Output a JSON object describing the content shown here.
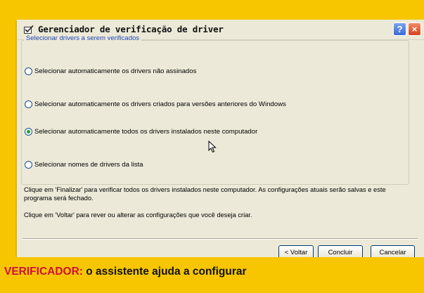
{
  "window": {
    "title": "Gerenciador de verificação de driver",
    "help_label": "?",
    "close_label": "×"
  },
  "group": {
    "legend": "Selecionar drivers a serem verificados",
    "options": [
      {
        "label": "Selecionar automaticamente os drivers não assinados",
        "selected": false
      },
      {
        "label": "Selecionar automaticamente os drivers criados para versões anteriores do Windows",
        "selected": false
      },
      {
        "label": "Selecionar automaticamente todos os drivers instalados neste computador",
        "selected": true
      },
      {
        "label": "Selecionar nomes de drivers da lista",
        "selected": false
      }
    ]
  },
  "info": {
    "finish_text": "Clique em 'Finalizar' para verificar todos os drivers instalados neste computador. As configurações atuais serão salvas e este programa será fechado.",
    "back_text": "Clique em 'Voltar' para rever ou alterar as configurações que você deseja criar."
  },
  "buttons": {
    "back": "< Voltar",
    "finish": "Concluir",
    "cancel": "Cancelar"
  },
  "caption": {
    "label": "VERIFICADOR:",
    "text": " o assistente ajuda a configurar"
  },
  "colors": {
    "background": "#f7c600",
    "window": "#ece9d8",
    "legend": "#1f47b8",
    "caption_label": "#d0103a",
    "selected_dot": "#1a9d29"
  },
  "icons": {
    "title": "driver-verifier-checkbox-icon",
    "cursor": "mouse-pointer-icon"
  }
}
